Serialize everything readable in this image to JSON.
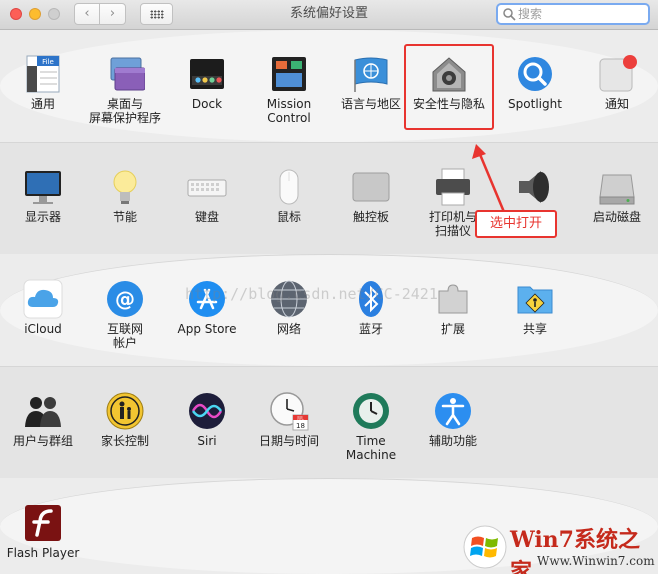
{
  "window": {
    "title": "系统偏好设置",
    "nav_back": "‹",
    "nav_forward": "›"
  },
  "search": {
    "placeholder": "搜索",
    "value": ""
  },
  "rows": [
    [
      "通用",
      "桌面与\n屏幕保护程序",
      "Dock",
      "Mission\nControl",
      "语言与地区",
      "安全性与隐私",
      "Spotlight",
      "通知"
    ],
    [
      "显示器",
      "节能",
      "键盘",
      "鼠标",
      "触控板",
      "打印机与\n扫描仪",
      "声音",
      "启动磁盘"
    ],
    [
      "iCloud",
      "互联网\n帐户",
      "App Store",
      "网络",
      "蓝牙",
      "扩展",
      "共享"
    ],
    [
      "用户与群组",
      "家长控制",
      "Siri",
      "日期与时间",
      "Time Machine",
      "辅助功能"
    ],
    [
      "Flash Player"
    ]
  ],
  "icon_labels": {
    "general_file": "File",
    "calendar_month": "JUL",
    "calendar_day": "18"
  },
  "annotation": {
    "text": "选中打开",
    "color": "#e8342f"
  },
  "watermark": {
    "text": "http://blog.csdn.net/CC-2421",
    "brand": "Win7系统之家",
    "url": "Www.Winwin7.com"
  },
  "colors": {
    "highlight": "#e8342f",
    "search_focus": "#7aaaf0"
  }
}
